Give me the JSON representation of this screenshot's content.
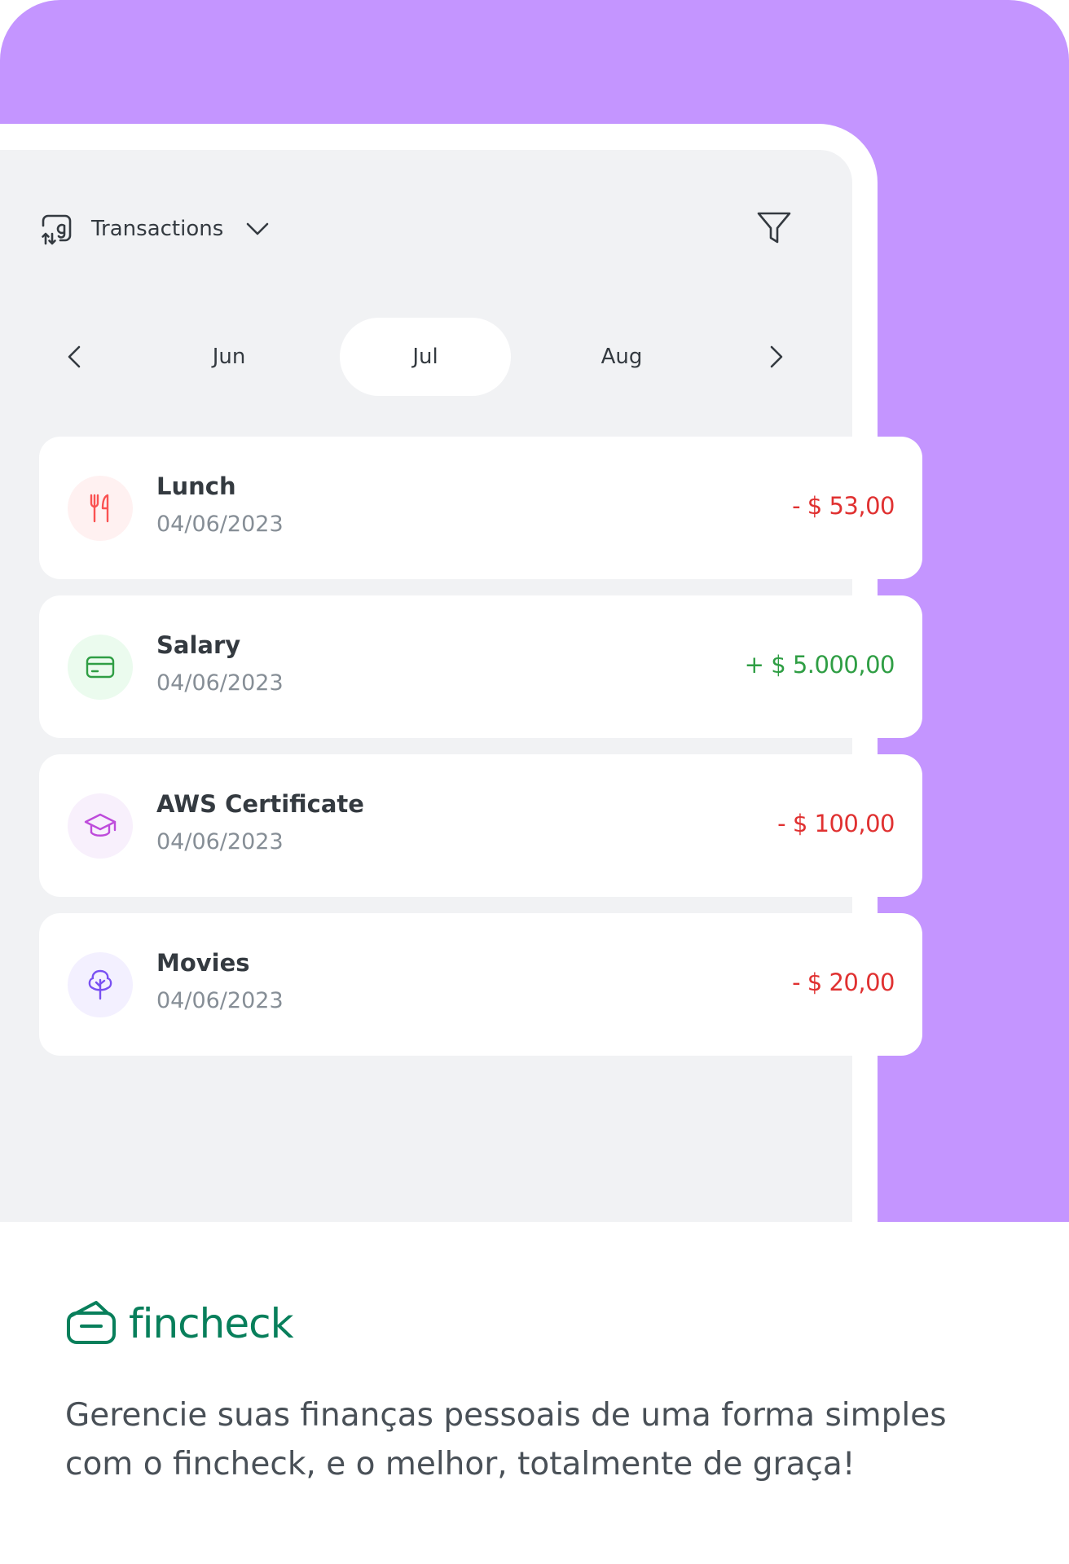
{
  "colors": {
    "hero_bg": "#c495ff",
    "screen_bg": "#f1f2f4",
    "expense": "#e03131",
    "income": "#2f9e44",
    "brand": "#087f5b"
  },
  "header": {
    "icon": "transactions-icon",
    "label": "Transactions",
    "dropdown_icon": "chevron-down-icon",
    "filter_icon": "filter-icon"
  },
  "month_nav": {
    "prev_icon": "chevron-left-icon",
    "next_icon": "chevron-right-icon",
    "months": [
      "Jun",
      "Jul",
      "Aug"
    ],
    "selected": "Jul"
  },
  "transactions": [
    {
      "name": "Lunch",
      "date": "04/06/2023",
      "amount": "- $ 53,00",
      "type": "expense",
      "icon": "utensils-icon"
    },
    {
      "name": "Salary",
      "date": "04/06/2023",
      "amount": "+ $ 5.000,00",
      "type": "income",
      "icon": "credit-card-icon"
    },
    {
      "name": "AWS Certificate",
      "date": "04/06/2023",
      "amount": "- $ 100,00",
      "type": "expense",
      "icon": "graduation-cap-icon"
    },
    {
      "name": "Movies",
      "date": "04/06/2023",
      "amount": "- $ 20,00",
      "type": "expense",
      "icon": "tree-icon"
    }
  ],
  "brand": {
    "logo_icon": "wallet-logo-icon",
    "name": "fincheck"
  },
  "tagline": "Gerencie suas finanças pessoais de uma forma simples com o fincheck, e o melhor, totalmente de graça!"
}
